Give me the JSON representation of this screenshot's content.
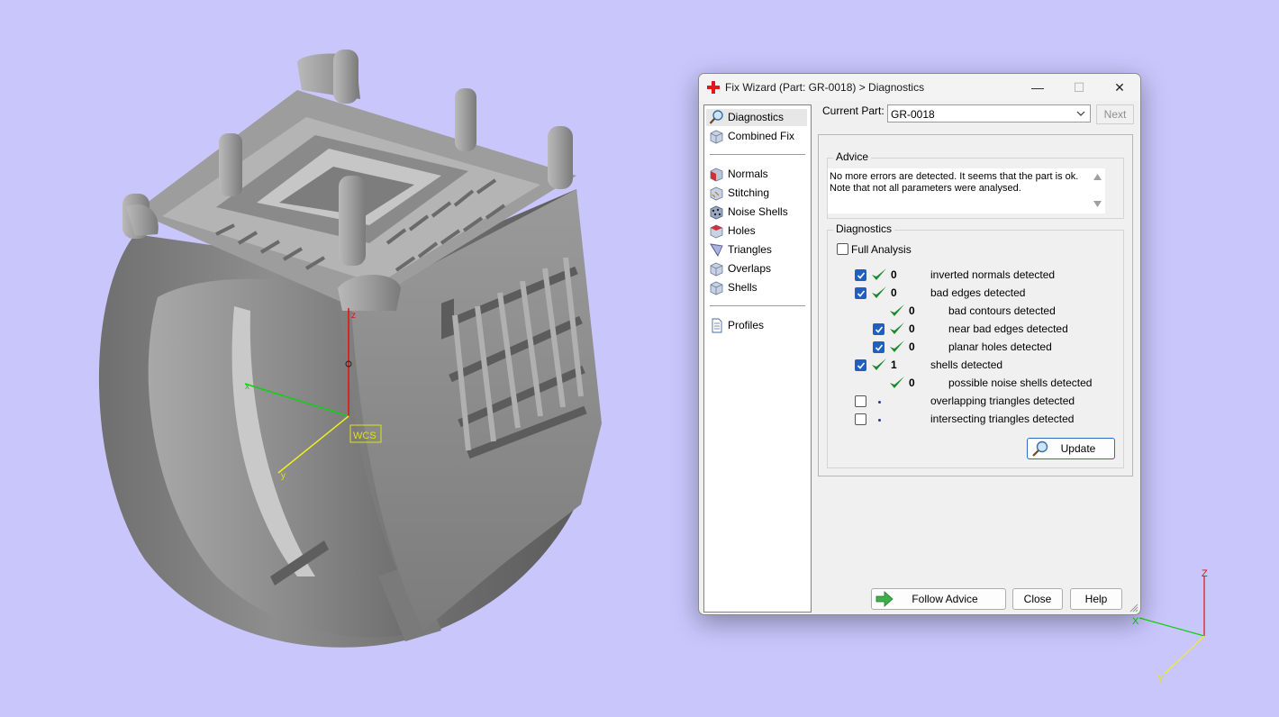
{
  "viewport": {
    "wcs_label": "WCS",
    "axis_labels": {
      "x": "x",
      "y": "y",
      "z": "z"
    },
    "corner_axis_labels": {
      "x": "X",
      "y": "Y",
      "z": "Z"
    },
    "background_color": "#c8c6fb"
  },
  "dialog": {
    "title": "Fix Wizard (Part: GR-0018) > Diagnostics",
    "window_buttons": {
      "minimize": "—",
      "maximize": "☐",
      "close": "✕"
    },
    "sidebar": {
      "group1": [
        {
          "label": "Diagnostics",
          "icon": "magnifier-icon",
          "selected": true
        },
        {
          "label": "Combined Fix",
          "icon": "cube-icon",
          "selected": false
        }
      ],
      "group2": [
        {
          "label": "Normals",
          "icon": "normals-cube-icon"
        },
        {
          "label": "Stitching",
          "icon": "stitching-cube-icon"
        },
        {
          "label": "Noise Shells",
          "icon": "noise-shells-icon"
        },
        {
          "label": "Holes",
          "icon": "holes-cube-icon"
        },
        {
          "label": "Triangles",
          "icon": "triangles-icon"
        },
        {
          "label": "Overlaps",
          "icon": "overlaps-cube-icon"
        },
        {
          "label": "Shells",
          "icon": "shells-cube-icon"
        }
      ],
      "group3": [
        {
          "label": "Profiles",
          "icon": "document-icon"
        }
      ]
    },
    "current_part": {
      "label": "Current Part:",
      "value": "GR-0018"
    },
    "next_label": "Next",
    "advice": {
      "title": "Advice",
      "line1": "No more errors are detected. It seems that the part is ok.",
      "line2": "Note that not all parameters were analysed."
    },
    "diagnostics": {
      "title": "Diagnostics",
      "full_analysis_label": "Full Analysis",
      "full_analysis_checked": false,
      "rows": [
        {
          "checked": true,
          "has_checkbox": true,
          "ok": true,
          "count": "0",
          "text": "inverted normals detected",
          "indent": 0
        },
        {
          "checked": true,
          "has_checkbox": true,
          "ok": true,
          "count": "0",
          "text": "bad edges detected",
          "indent": 0
        },
        {
          "checked": false,
          "has_checkbox": false,
          "ok": true,
          "count": "0",
          "text": "bad contours detected",
          "indent": 1
        },
        {
          "checked": true,
          "has_checkbox": true,
          "ok": true,
          "count": "0",
          "text": "near bad edges detected",
          "indent": 1
        },
        {
          "checked": true,
          "has_checkbox": true,
          "ok": true,
          "count": "0",
          "text": "planar holes detected",
          "indent": 1
        },
        {
          "checked": true,
          "has_checkbox": true,
          "ok": true,
          "count": "1",
          "text": "shells detected",
          "indent": 0
        },
        {
          "checked": false,
          "has_checkbox": false,
          "ok": true,
          "count": "0",
          "text": "possible noise shells detected",
          "indent": 1
        },
        {
          "checked": false,
          "has_checkbox": true,
          "ok": false,
          "count": "",
          "text": "overlapping triangles detected",
          "indent": 0
        },
        {
          "checked": false,
          "has_checkbox": true,
          "ok": false,
          "count": "",
          "text": "intersecting triangles detected",
          "indent": 0
        }
      ],
      "update_label": "Update"
    },
    "buttons": {
      "follow_advice": "Follow Advice",
      "close": "Close",
      "help": "Help"
    },
    "colors": {
      "accent": "#1e5fbf",
      "ok_green": "#1a8a2e"
    }
  }
}
